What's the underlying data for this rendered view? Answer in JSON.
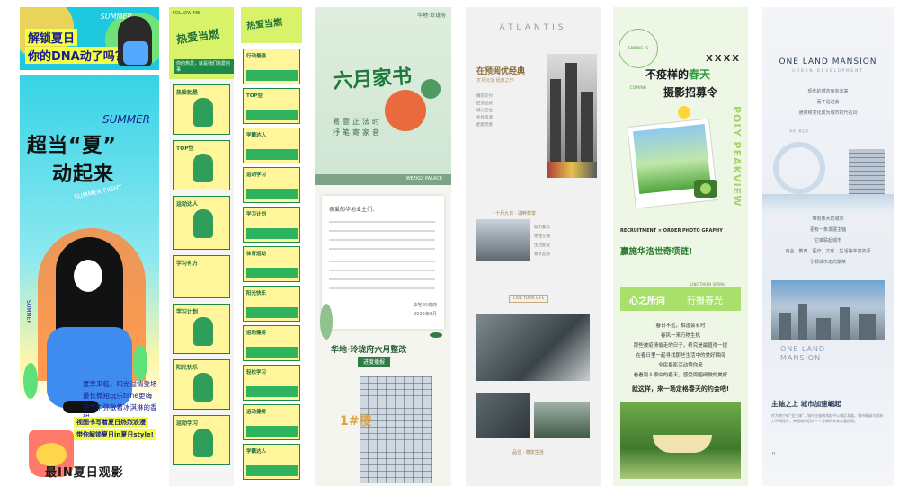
{
  "p1": {
    "top_tag": "SUMMER",
    "top_line1": "解锁夏日",
    "top_line2": "你的DNA动了吗？",
    "summer": "SUMMER",
    "big1": "超当“夏”",
    "big2": "动起来",
    "slant": "SUMMER FIGHT",
    "side": "SUMMER",
    "lines": [
      "夏季来临，阳光溢情登场",
      "最长微短玩乐time更嗨",
      "空气中弥散着冰淇淋的香甜"
    ],
    "hl1": "视图书写着夏日热烈浪漫",
    "hl2": "带你解锁夏日in夏日style!",
    "bottom": "最IN夏日观影"
  },
  "p2": {
    "lab": "FOLLOW ME",
    "title": "热爱当燃",
    "sub": "你的热爱，就是我们热爱的事",
    "cards": [
      "热爱就是",
      "TOP型",
      "运动达人",
      "学习有方",
      "学习计划",
      "阳光快乐",
      "运动学习"
    ]
  },
  "p3": {
    "title": "热爱当燃",
    "cards": [
      "行动最强",
      "TOP型",
      "学霸达人",
      "运动学习",
      "学习计划",
      "体育运动",
      "阳光快乐",
      "运动健将",
      "轻松学习",
      "运动健将",
      "学霸达人"
    ]
  },
  "p4": {
    "logo": "华地·玲珑府",
    "calligraphy": "六月家书",
    "poem_line1": "易意正法时",
    "poem_line2": "抒笔寄家音",
    "band": "WEEKLY PALACE",
    "letter_title": "亲爱的华地业主们：",
    "letter_sign": "华地·玲珑府",
    "letter_date": "2022年6月",
    "title2": "华地·玲珑府六月整改",
    "badge": "进度播报",
    "floor": "1#楼"
  },
  "p5": {
    "brand": "ATLANTIS",
    "title": "在预阅优经典",
    "subtitle": "岁月沉淀 经典之作",
    "list": [
      "精装交付",
      "匠造品质",
      "城心区位",
      "名校资源",
      "配套完善"
    ],
    "section": "· 十月九日 ·  湖畔尊享",
    "descs": [
      "城市繁华",
      "便捷交通",
      "生活配套",
      "尊享品质"
    ],
    "pill": "LIVE YOUR LIFE",
    "foot": "品位 · 尊享生活"
  },
  "p6": {
    "circle": "SPRING IS COMING",
    "xxxx": "XXXX",
    "t1_a": "不疫样的",
    "t1_b": "春天",
    "t2": "摄影招募令",
    "vert": "POLY PEAKVIEW",
    "recruit": "RECRUITMENT × ORDER  PHOTO GRAPHY",
    "win": "赢施华洛世奇项链!",
    "band_a": "心之所向",
    "band_b": "行摄春光",
    "band_small": "LINE TAKEN SPRING",
    "lines": [
      "春日不远，相逢会有时",
      "春风一来万物生机",
      "那些被疫情偷走的日子，终究是最值得一提",
      "在春日里一起寻找那些生活中的美好瞬间",
      "全民摄影活动等你来",
      "看看别人眼中的春天，感受周围细微的美好"
    ],
    "bold": "就这样，来一场定格春天的约会吧!"
  },
  "p7": {
    "brand": "ONE LAND MANSION",
    "brand2": "URBAN DEVELOPMENT",
    "intro": [
      "现代的城市面向未来",
      "而不是过去",
      "通常和变化成为城市的代名词"
    ],
    "sig": "未来 · 新主城",
    "mid": [
      "唯有伟大的城市",
      "更有一条发展主轴",
      "它串联起城市",
      "商业、教育、医疗、文化、生活等丰富资源",
      "引领城市走向繁荣"
    ],
    "brand3a": "ONE LAND",
    "brand3b": "MANSION",
    "h": "主轴之上 城市加速崛起",
    "p": "作为南宁的“金主轴”，城市主轴线串起中心城区发展，城市能级与影响力不断提升，带领城市迈向一个全新的未来发展阶段。",
    "q": "“"
  }
}
